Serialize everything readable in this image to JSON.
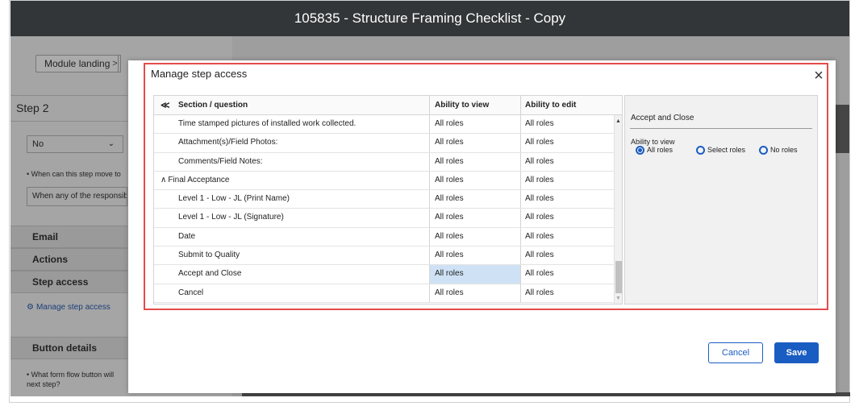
{
  "window": {
    "title": "105835 - Structure Framing Checklist - Copy"
  },
  "background": {
    "breadcrumb": "Module landing",
    "breadcrumb_arrow": ">",
    "step_title": "Step 2",
    "select_value": "No",
    "when_hint": "• When can this step move to",
    "when_value": "When any of the responsibl",
    "sections": [
      "Email",
      "Actions",
      "Step access"
    ],
    "manage_link": "Manage step access",
    "button_details": "Button details",
    "button_hint": "• What form flow button will next step?"
  },
  "modal": {
    "title": "Manage step access",
    "close_label": "×",
    "columns": {
      "collapse_icon": "≪",
      "question": "Section / question",
      "view": "Ability to view",
      "edit": "Ability to edit"
    },
    "rows": [
      {
        "label": "Time stamped pictures of installed work collected.",
        "type": "question",
        "view": "All roles",
        "edit": "All roles"
      },
      {
        "label": "Attachment(s)/Field Photos:",
        "type": "question",
        "view": "All roles",
        "edit": "All roles"
      },
      {
        "label": "Comments/Field Notes:",
        "type": "question",
        "view": "All roles",
        "edit": "All roles"
      },
      {
        "label": "Final Acceptance",
        "type": "section",
        "view": "All roles",
        "edit": "All roles"
      },
      {
        "label": "Level 1 - Low - JL (Print Name)",
        "type": "question",
        "view": "All roles",
        "edit": "All roles"
      },
      {
        "label": "Level 1 - Low - JL (Signature)",
        "type": "question",
        "view": "All roles",
        "edit": "All roles"
      },
      {
        "label": "Date",
        "type": "question",
        "view": "All roles",
        "edit": "All roles"
      },
      {
        "label": "Submit to Quality",
        "type": "question",
        "view": "All roles",
        "edit": "All roles"
      },
      {
        "label": "Accept and Close",
        "type": "question",
        "view": "All roles",
        "edit": "All roles",
        "selected": true
      },
      {
        "label": "Cancel",
        "type": "question",
        "view": "All roles",
        "edit": "All roles"
      }
    ],
    "detail": {
      "name": "Accept and Close",
      "label": "Ability to view",
      "options": [
        {
          "label": "All roles",
          "checked": true
        },
        {
          "label": "Select roles",
          "checked": false
        },
        {
          "label": "No roles",
          "checked": false
        }
      ]
    },
    "buttons": {
      "cancel": "Cancel",
      "save": "Save"
    }
  },
  "colors": {
    "accent": "#1a5dc2",
    "highlight_border": "#e34b4b",
    "selected_cell": "#cfe2f5"
  }
}
